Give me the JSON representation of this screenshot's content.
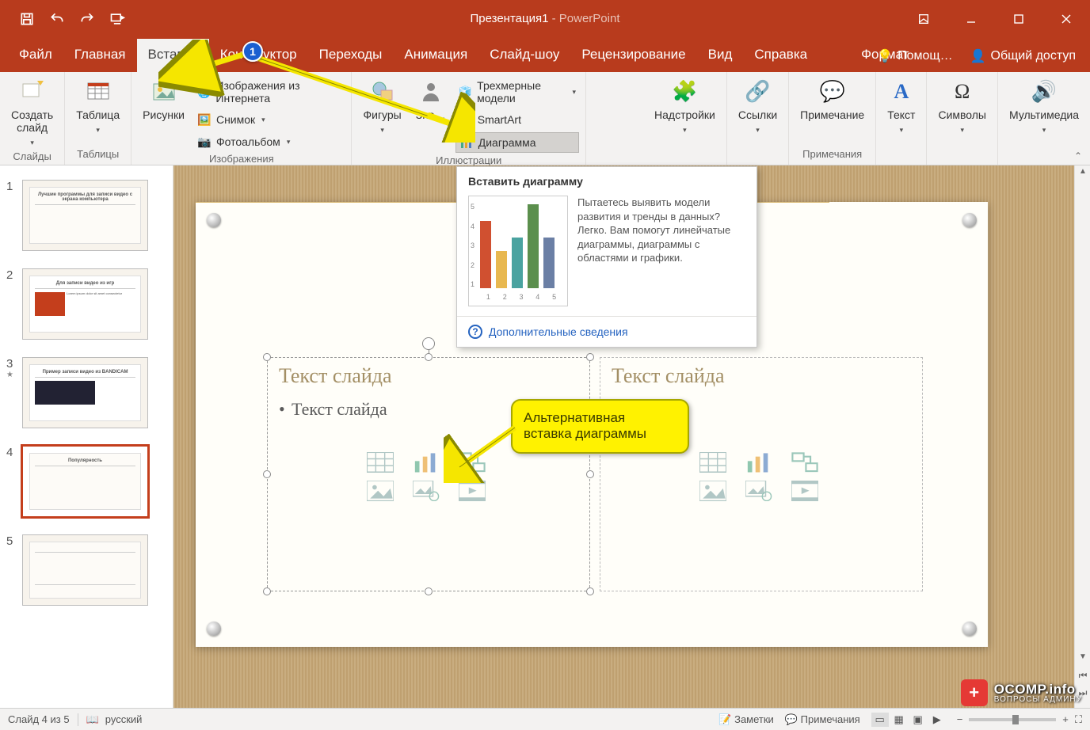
{
  "title": {
    "doc": "Презентация1",
    "sep": " - ",
    "app": "PowerPoint"
  },
  "tabs": {
    "items": [
      "Файл",
      "Главная",
      "Вставка",
      "Конструктор",
      "Переходы",
      "Анимация",
      "Слайд-шоу",
      "Рецензирование",
      "Вид",
      "Справка"
    ],
    "context": "Формат",
    "active_index": 2,
    "help": "Помощ…",
    "share": "Общий доступ"
  },
  "ribbon": {
    "slides": {
      "new_slide": "Создать\nслайд",
      "group": "Слайды"
    },
    "tables": {
      "table": "Таблица",
      "group": "Таблицы"
    },
    "images": {
      "pictures": "Рисунки",
      "online": "Изображения из Интернета",
      "screenshot": "Снимок",
      "album": "Фотоальбом",
      "group": "Изображения"
    },
    "illustr": {
      "shapes": "Фигуры",
      "icons": "Зна…",
      "models": "Трехмерные модели",
      "smartart": "SmartArt",
      "chart": "Диаграмма",
      "group": "Иллюстрации"
    },
    "addins": {
      "label": "Надстройки"
    },
    "links": {
      "label": "Ссылки"
    },
    "comments": {
      "new": "Примечание",
      "group": "Примечания"
    },
    "text": {
      "label": "Текст"
    },
    "symbols": {
      "label": "Символы"
    },
    "media": {
      "label": "Мультимедиа"
    }
  },
  "tooltip": {
    "title": "Вставить диаграмму",
    "desc": "Пытаетесь выявить модели развития и тренды в данных? Легко. Вам помогут линейчатые диаграммы, диаграммы с областями и графики.",
    "link": "Дополнительные сведения"
  },
  "chart_data": {
    "type": "bar",
    "categories": [
      "1",
      "2",
      "3",
      "4",
      "5"
    ],
    "values": [
      4.0,
      2.2,
      3.0,
      5.0,
      3.0
    ],
    "colors": [
      "#d05030",
      "#e8b850",
      "#4aa3a0",
      "#5b8f4d",
      "#6b7fa5"
    ],
    "ylim": [
      0,
      5
    ],
    "yticks": [
      "1",
      "2",
      "3",
      "4",
      "5"
    ]
  },
  "slide": {
    "ph_title": "Текст слайда",
    "ph_bullet": "Текст слайда"
  },
  "callout": "Альтернативная вставка диаграммы",
  "marker": "1",
  "thumbs": [
    {
      "n": "1",
      "title": "Лучшие программы для записи видео с экрана компьютера"
    },
    {
      "n": "2",
      "title": "Для записи видео из игр"
    },
    {
      "n": "3",
      "title": "Пример записи видео из BANDICAM",
      "star": true
    },
    {
      "n": "4",
      "title": "Популярность",
      "selected": true
    },
    {
      "n": "5",
      "title": ""
    }
  ],
  "status": {
    "slide": "Слайд 4 из 5",
    "lang": "русский",
    "notes": "Заметки",
    "comments": "Примечания",
    "zoom_minus": "−",
    "zoom_plus": "+"
  },
  "watermark": {
    "line1": "OCOMP.info",
    "line2": "ВОПРОСЫ АДМИНУ"
  }
}
